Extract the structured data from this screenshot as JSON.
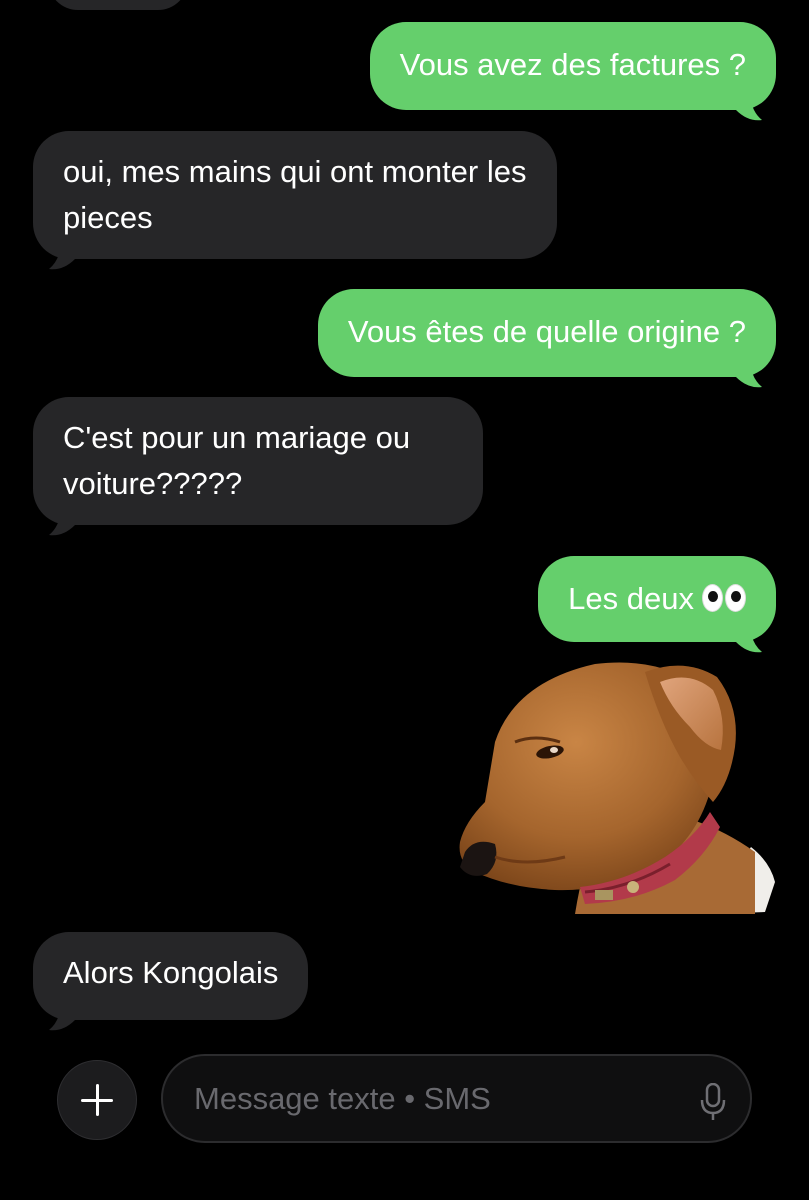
{
  "conversation": {
    "messages": [
      {
        "direction": "outgoing",
        "text": "Vous avez des factures ?"
      },
      {
        "direction": "incoming",
        "text": "oui, mes mains qui ont monter les pieces"
      },
      {
        "direction": "outgoing",
        "text": "Vous êtes de quelle origine ?"
      },
      {
        "direction": "incoming",
        "text": "C'est pour un mariage ou voiture?????"
      },
      {
        "direction": "outgoing",
        "text": "Les deux",
        "emoji": "eyes"
      },
      {
        "direction": "outgoing",
        "type": "sticker",
        "sticker": "side-eye-dog"
      },
      {
        "direction": "incoming",
        "text": "Alors Kongolais"
      }
    ]
  },
  "composer": {
    "placeholder": "Message texte • SMS",
    "add_icon": "plus-icon",
    "mic_icon": "microphone-icon"
  },
  "colors": {
    "background": "#000000",
    "outgoing_bubble": "#65cf6c",
    "incoming_bubble": "#262628",
    "text": "#ffffff",
    "placeholder": "#69696e"
  }
}
